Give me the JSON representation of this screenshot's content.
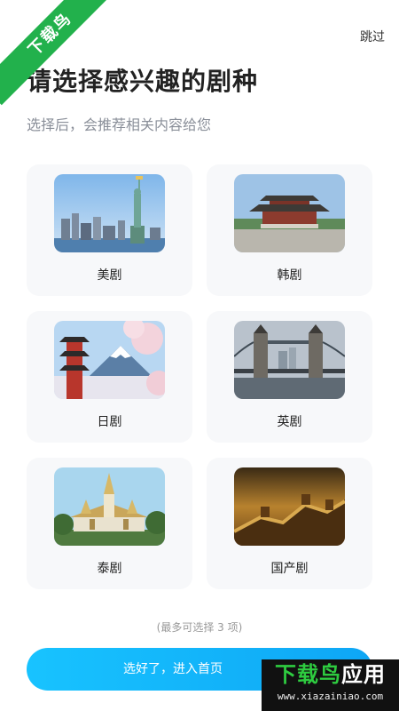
{
  "watermark": {
    "corner": "下载鸟",
    "brand_green": "下载鸟",
    "brand_white": "应用",
    "url": "www.xiazainiao.com"
  },
  "header": {
    "skip": "跳过",
    "title": "请选择感兴趣的剧种",
    "subtitle": "选择后，会推荐相关内容给您"
  },
  "genres": [
    {
      "label": "美剧",
      "icon": "statue-of-liberty-photo"
    },
    {
      "label": "韩剧",
      "icon": "korean-palace-photo"
    },
    {
      "label": "日剧",
      "icon": "mount-fuji-pagoda-photo"
    },
    {
      "label": "英剧",
      "icon": "tower-bridge-photo"
    },
    {
      "label": "泰剧",
      "icon": "thai-temple-photo"
    },
    {
      "label": "国产剧",
      "icon": "great-wall-photo"
    }
  ],
  "footer": {
    "hint": "(最多可选择 3 项)",
    "cta": "选好了，进入首页"
  },
  "colors": {
    "accent": "#12b5fb",
    "card_bg": "#f7f8fa",
    "watermark_green": "#22b14c"
  }
}
